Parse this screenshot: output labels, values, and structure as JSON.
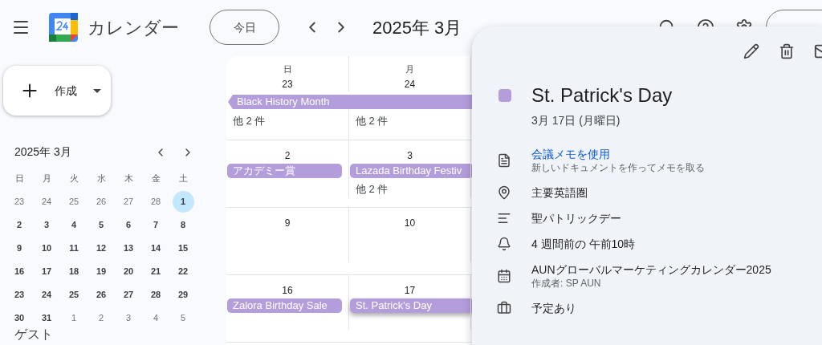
{
  "header": {
    "app_title": "カレンダー",
    "today_button": "今日",
    "period": "2025年 3月"
  },
  "create_button": "作成",
  "mini_calendar": {
    "title": "2025年 3月",
    "weekdays": [
      "日",
      "月",
      "火",
      "水",
      "木",
      "金",
      "土"
    ],
    "days": [
      {
        "label": "23",
        "outside": true,
        "selected": false
      },
      {
        "label": "24",
        "outside": true,
        "selected": false
      },
      {
        "label": "25",
        "outside": true,
        "selected": false
      },
      {
        "label": "26",
        "outside": true,
        "selected": false
      },
      {
        "label": "27",
        "outside": true,
        "selected": false
      },
      {
        "label": "28",
        "outside": true,
        "selected": false
      },
      {
        "label": "1",
        "outside": false,
        "selected": true
      },
      {
        "label": "2",
        "outside": false,
        "selected": false
      },
      {
        "label": "3",
        "outside": false,
        "selected": false
      },
      {
        "label": "4",
        "outside": false,
        "selected": false
      },
      {
        "label": "5",
        "outside": false,
        "selected": false
      },
      {
        "label": "6",
        "outside": false,
        "selected": false
      },
      {
        "label": "7",
        "outside": false,
        "selected": false
      },
      {
        "label": "8",
        "outside": false,
        "selected": false
      },
      {
        "label": "9",
        "outside": false,
        "selected": false
      },
      {
        "label": "10",
        "outside": false,
        "selected": false
      },
      {
        "label": "11",
        "outside": false,
        "selected": false
      },
      {
        "label": "12",
        "outside": false,
        "selected": false
      },
      {
        "label": "13",
        "outside": false,
        "selected": false
      },
      {
        "label": "14",
        "outside": false,
        "selected": false
      },
      {
        "label": "15",
        "outside": false,
        "selected": false
      },
      {
        "label": "16",
        "outside": false,
        "selected": false
      },
      {
        "label": "17",
        "outside": false,
        "selected": false
      },
      {
        "label": "18",
        "outside": false,
        "selected": false
      },
      {
        "label": "19",
        "outside": false,
        "selected": false
      },
      {
        "label": "20",
        "outside": false,
        "selected": false
      },
      {
        "label": "21",
        "outside": false,
        "selected": false
      },
      {
        "label": "22",
        "outside": false,
        "selected": false
      },
      {
        "label": "23",
        "outside": false,
        "selected": false
      },
      {
        "label": "24",
        "outside": false,
        "selected": false
      },
      {
        "label": "25",
        "outside": false,
        "selected": false
      },
      {
        "label": "26",
        "outside": false,
        "selected": false
      },
      {
        "label": "27",
        "outside": false,
        "selected": false
      },
      {
        "label": "28",
        "outside": false,
        "selected": false
      },
      {
        "label": "29",
        "outside": false,
        "selected": false
      },
      {
        "label": "30",
        "outside": false,
        "selected": false
      },
      {
        "label": "31",
        "outside": false,
        "selected": false
      },
      {
        "label": "1",
        "outside": true,
        "selected": false
      },
      {
        "label": "2",
        "outside": true,
        "selected": false
      },
      {
        "label": "3",
        "outside": true,
        "selected": false
      },
      {
        "label": "4",
        "outside": true,
        "selected": false
      },
      {
        "label": "5",
        "outside": true,
        "selected": false
      }
    ]
  },
  "guests_label": "ゲスト",
  "month_grid": {
    "weekdays": [
      "日",
      "月"
    ],
    "weeks": [
      {
        "banner": "Black History Month",
        "cells": [
          {
            "date": "23",
            "more": "他 2 件"
          },
          {
            "date": "24",
            "more": "他 2 件"
          }
        ]
      },
      {
        "cells": [
          {
            "date": "2",
            "events": [
              {
                "title": "アカデミー賞",
                "selected": false
              }
            ]
          },
          {
            "date": "3",
            "events": [
              {
                "title": "Lazada Birthday Festiv",
                "selected": false
              }
            ],
            "more": "他 2 件"
          }
        ]
      },
      {
        "cells": [
          {
            "date": "9"
          },
          {
            "date": "10"
          }
        ]
      },
      {
        "cells": [
          {
            "date": "16",
            "events": [
              {
                "title": "Zalora Birthday Sale",
                "selected": false
              }
            ]
          },
          {
            "date": "17",
            "events": [
              {
                "title": "St. Patrick's Day",
                "selected": true
              }
            ]
          }
        ]
      }
    ]
  },
  "event_popup": {
    "color": "#b39ddb",
    "title": "St. Patrick's Day",
    "date": "3月 17日 (月曜日)",
    "details": [
      {
        "kind": "notes",
        "text": "会議メモを使用",
        "sub": "新しいドキュメントを作ってメモを取る"
      },
      {
        "kind": "location",
        "text": "主要英語圏"
      },
      {
        "kind": "description",
        "text": "聖パトリックデー"
      },
      {
        "kind": "reminder",
        "text": "4 週間前の 午前10時"
      },
      {
        "kind": "calendar",
        "text": "AUNグローバルマーケティングカレンダー2025",
        "sub": "作成者: SP AUN"
      },
      {
        "kind": "availability",
        "text": "予定あり"
      }
    ]
  }
}
